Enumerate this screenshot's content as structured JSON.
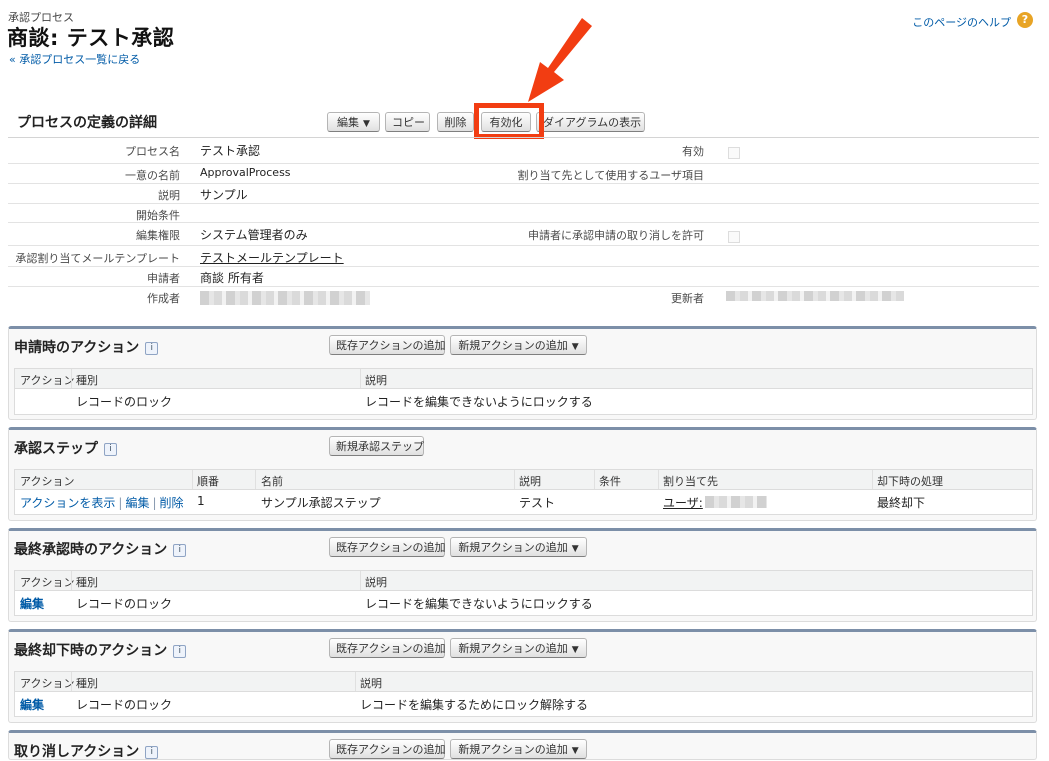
{
  "header": {
    "breadcrumb": "承認プロセス",
    "title": "商談: テスト承認",
    "back_link": "« 承認プロセス一覧に戻る",
    "help_link": "このページのヘルプ",
    "help_icon": "?"
  },
  "detail": {
    "section_title": "プロセスの定義の詳細",
    "buttons": {
      "edit": "編集",
      "copy": "コピー",
      "delete": "削除",
      "activate": "有効化",
      "diagram": "ダイアグラムの表示"
    },
    "fields": {
      "process_name_label": "プロセス名",
      "process_name": "テスト承認",
      "active_label": "有効",
      "unique_name_label": "一意の名前",
      "unique_name": "ApprovalProcess",
      "assignee_field_label": "割り当て先として使用するユーザ項目",
      "description_label": "説明",
      "description": "サンプル",
      "entry_criteria_label": "開始条件",
      "edit_permission_label": "編集権限",
      "edit_permission": "システム管理者のみ",
      "allow_recall_label": "申請者に承認申請の取り消しを許可",
      "email_template_label": "承認割り当てメールテンプレート",
      "email_template": "テストメールテンプレート",
      "submitter_label": "申請者",
      "submitter": "商談 所有者",
      "created_by_label": "作成者",
      "modified_by_label": "更新者"
    }
  },
  "common": {
    "add_existing": "既存アクションの追加",
    "add_new": "新規アクションの追加",
    "info_icon": "i",
    "col_action": "アクション",
    "col_type": "種別",
    "col_description": "説明",
    "lock_record": "レコードのロック",
    "edit": "編集"
  },
  "submit_actions": {
    "title": "申請時のアクション",
    "row_description": "レコードを編集できないようにロックする"
  },
  "approval_steps": {
    "title": "承認ステップ",
    "new_step_button": "新規承認ステップ",
    "columns": [
      "アクション",
      "順番",
      "名前",
      "説明",
      "条件",
      "割り当て先",
      "却下時の処理"
    ],
    "row": {
      "show_actions": "アクションを表示",
      "edit": "編集",
      "delete": "削除",
      "order": "1",
      "name": "サンプル承認ステップ",
      "description": "テスト",
      "assignee_prefix": "ユーザ:",
      "reject_behavior": "最終却下"
    }
  },
  "final_approval": {
    "title": "最終承認時のアクション",
    "row_description": "レコードを編集できないようにロックする"
  },
  "final_rejection": {
    "title": "最終却下時のアクション",
    "row_description": "レコードを編集するためにロック解除する"
  },
  "recall_actions": {
    "title": "取り消しアクション"
  }
}
